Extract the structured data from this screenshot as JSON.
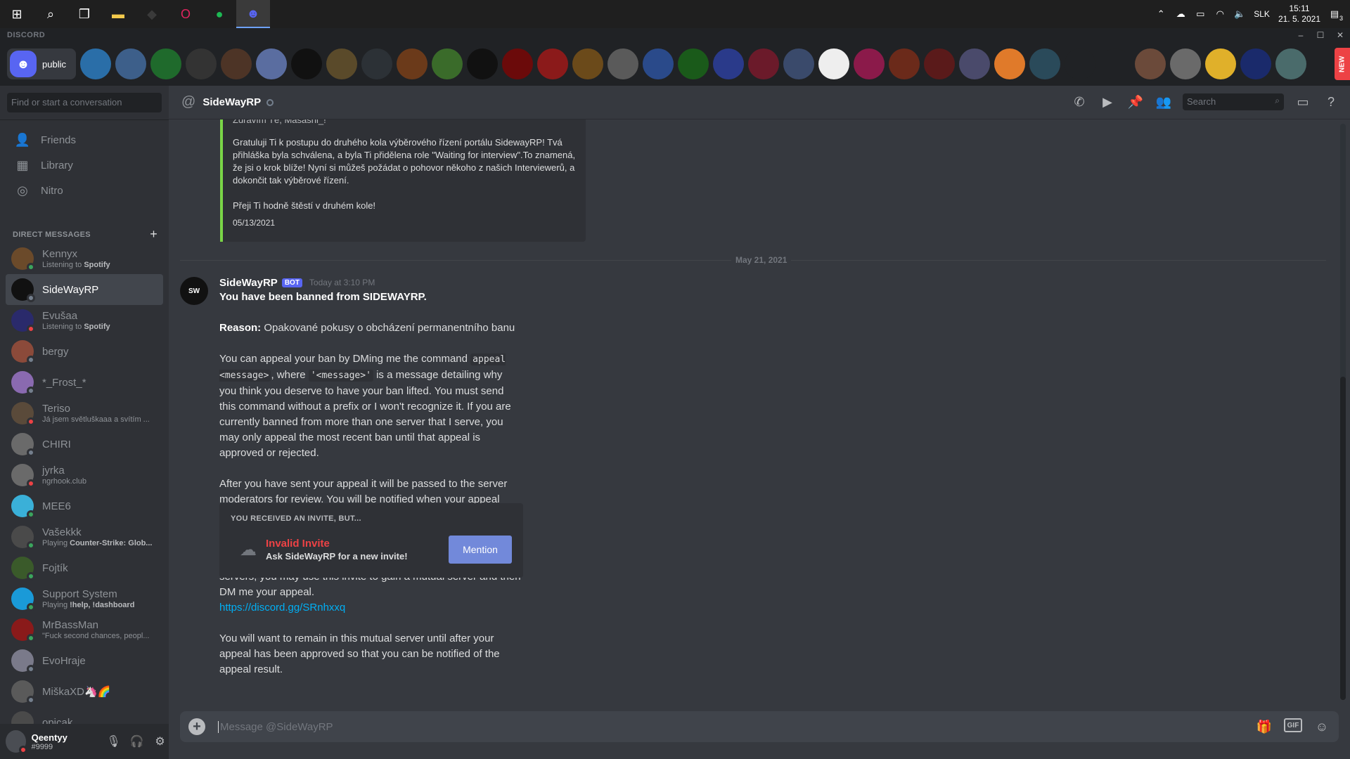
{
  "taskbar": {
    "apps": [
      {
        "icon": "windows-icon",
        "color": "#ffffff"
      },
      {
        "icon": "search-icon",
        "color": "#ffffff"
      },
      {
        "icon": "task-view-icon",
        "color": "#ffffff"
      },
      {
        "icon": "file-explorer-icon",
        "color": "#f2c94c"
      },
      {
        "icon": "app-icon-1",
        "color": "#3a3a3a"
      },
      {
        "icon": "opera-icon",
        "color": "#e0245e"
      },
      {
        "icon": "spotify-icon",
        "color": "#1db954"
      },
      {
        "icon": "discord-taskbar-icon",
        "color": "#5865f2"
      }
    ],
    "language": "SLK",
    "time": "15:11",
    "date": "21. 5. 2021",
    "notifications": "3"
  },
  "app": {
    "name": "DISCORD",
    "home_label": "public",
    "new_badge": "NEW"
  },
  "servers": [
    "#2a6ea8",
    "#3d5f8a",
    "#1f6a2c",
    "#333",
    "#4d3426",
    "#5a6da0",
    "#111",
    "#5a4a2a",
    "#2c3136",
    "#6b3a1a",
    "#3a6b2a",
    "#111",
    "#6b0a0a",
    "#8b1a1a",
    "#6b4a1a",
    "#5a5a5a",
    "#2a4a8a",
    "#1a5a1a",
    "#2a3a8a",
    "#6b1a2a",
    "#3a4a6b",
    "#eeeeee",
    "#8b1a4a",
    "#6b2a1a",
    "#5a1a1a",
    "#4a4a6b",
    "#e07a2a",
    "#2a4a5a",
    "#202225",
    "#202225",
    "#6b4a3a",
    "#6a6a6a",
    "#e0b02a",
    "#1a2a6b",
    "#4a6b6b",
    "#3a4a3a"
  ],
  "sidebar": {
    "search_placeholder": "Find or start a conversation",
    "nav": [
      {
        "label": "Friends",
        "icon": "friends-icon"
      },
      {
        "label": "Library",
        "icon": "library-icon"
      },
      {
        "label": "Nitro",
        "icon": "nitro-icon"
      }
    ],
    "dm_header": "DIRECT MESSAGES",
    "dms": [
      {
        "name": "Kennyx",
        "sub_prefix": "Listening to ",
        "sub_bold": "Spotify",
        "status": "online",
        "color": "#6b4a2a"
      },
      {
        "name": "SideWayRP",
        "sub_prefix": "",
        "sub_bold": "",
        "status": "off",
        "color": "#111111",
        "active": true
      },
      {
        "name": "Evušaa",
        "sub_prefix": "Listening to ",
        "sub_bold": "Spotify",
        "status": "dnd",
        "color": "#2a2a6b"
      },
      {
        "name": "bergy",
        "sub_prefix": "",
        "sub_bold": "",
        "status": "off",
        "color": "#8b4a3a"
      },
      {
        "name": "*_Frost_*",
        "sub_prefix": "",
        "sub_bold": "",
        "status": "off",
        "color": "#8a6ab0"
      },
      {
        "name": "Teriso",
        "sub_prefix": "Já jsem světluškaaa a svítím ...",
        "sub_bold": "",
        "status": "dnd",
        "color": "#5a4a3a"
      },
      {
        "name": "CHIRI",
        "sub_prefix": "",
        "sub_bold": "",
        "status": "off",
        "color": "#6a6a6a"
      },
      {
        "name": "jyrka",
        "sub_prefix": "ngrhook.club",
        "sub_bold": "",
        "status": "dnd",
        "color": "#6a6a6a"
      },
      {
        "name": "MEE6",
        "sub_prefix": "",
        "sub_bold": "",
        "status": "online",
        "color": "#3ab0d8"
      },
      {
        "name": "Vašekkk",
        "sub_prefix": "Playing ",
        "sub_bold": "Counter-Strike: Glob...",
        "status": "online",
        "color": "#4a4a4a"
      },
      {
        "name": "Fojtík",
        "sub_prefix": "",
        "sub_bold": "",
        "status": "online",
        "color": "#3a5a2a"
      },
      {
        "name": "Support System",
        "sub_prefix": "Playing ",
        "sub_bold": "!help, !dashboard",
        "status": "online",
        "color": "#1a9ad8"
      },
      {
        "name": "MrBassMan",
        "sub_prefix": "\"Fuck second chances, peopl...",
        "sub_bold": "",
        "status": "online",
        "color": "#8a1a1a"
      },
      {
        "name": "EvoHraje",
        "sub_prefix": "",
        "sub_bold": "",
        "status": "off",
        "color": "#7a7a8a"
      },
      {
        "name": "MiškaXD🦄🌈",
        "sub_prefix": "",
        "sub_bold": "",
        "status": "off",
        "color": "#5a5a5a"
      },
      {
        "name": "opicak",
        "sub_prefix": "",
        "sub_bold": "",
        "status": "off",
        "color": "#4a4a4a"
      }
    ],
    "user": {
      "name": "Qeentyy",
      "tag": "#9999"
    }
  },
  "header": {
    "channel": "SideWayRP",
    "search_placeholder": "Search"
  },
  "chat": {
    "prev_embed": {
      "cut_line": "Zdravím Tě, Masashi_!",
      "paragraph": "Gratuluji Ti k postupu do druhého kola výběrového řízení portálu SidewayRP! Tvá přihláška byla schválena, a byla Ti přidělena role \"Waiting for interview\".To znamená, že jsi o krok blíže! Nyní si můžeš požádat o pohovor někoho z našich Interviewerů, a dokončit tak výběrové řízení.",
      "wish": "Přeji Ti hodně štěstí v druhém kole!",
      "date": "05/13/2021"
    },
    "divider": "May 21, 2021",
    "message": {
      "author": "SideWayRP",
      "bot_tag": "BOT",
      "timestamp": "Today at 3:10 PM",
      "title": "You have been banned from SIDEWAYRP.",
      "reason_label": "Reason:",
      "reason": " Opakované pokusy o obcházení permanentního banu",
      "p1_a": "You can appeal your ban by DMing me the command ",
      "p1_code1": "appeal <message>",
      "p1_b": ", where ",
      "p1_code2": "'<message>'",
      "p1_c": " is a message detailing why you think you deserve to have your ban lifted. You must send this command without a prefix or I won't recognize it. If you are currently banned from more than one server that I serve, you may only appeal the most recent ban until that appeal is approved or rejected.",
      "p2": "After you have sent your appeal it will be passed to the server moderators for review. You will be notified when your appeal has been approved or rejected. If your appeal is rejected, you may not appeal again.",
      "p3": "If you are unable to DM me because we do not have any mutual servers, you may use this invite to gain a mutual server and then DM me your appeal.",
      "link": "https://discord.gg/SRnhxxq",
      "p4": "You will want to remain in this mutual server until after your appeal has been approved so that you can be notified of the appeal result."
    },
    "invite": {
      "heading": "YOU RECEIVED AN INVITE, BUT...",
      "title": "Invalid Invite",
      "subtitle": "Ask SideWayRP for a new invite!",
      "button": "Mention"
    }
  },
  "composer": {
    "placeholder": "Message @SideWayRP",
    "gif_label": "GIF"
  }
}
